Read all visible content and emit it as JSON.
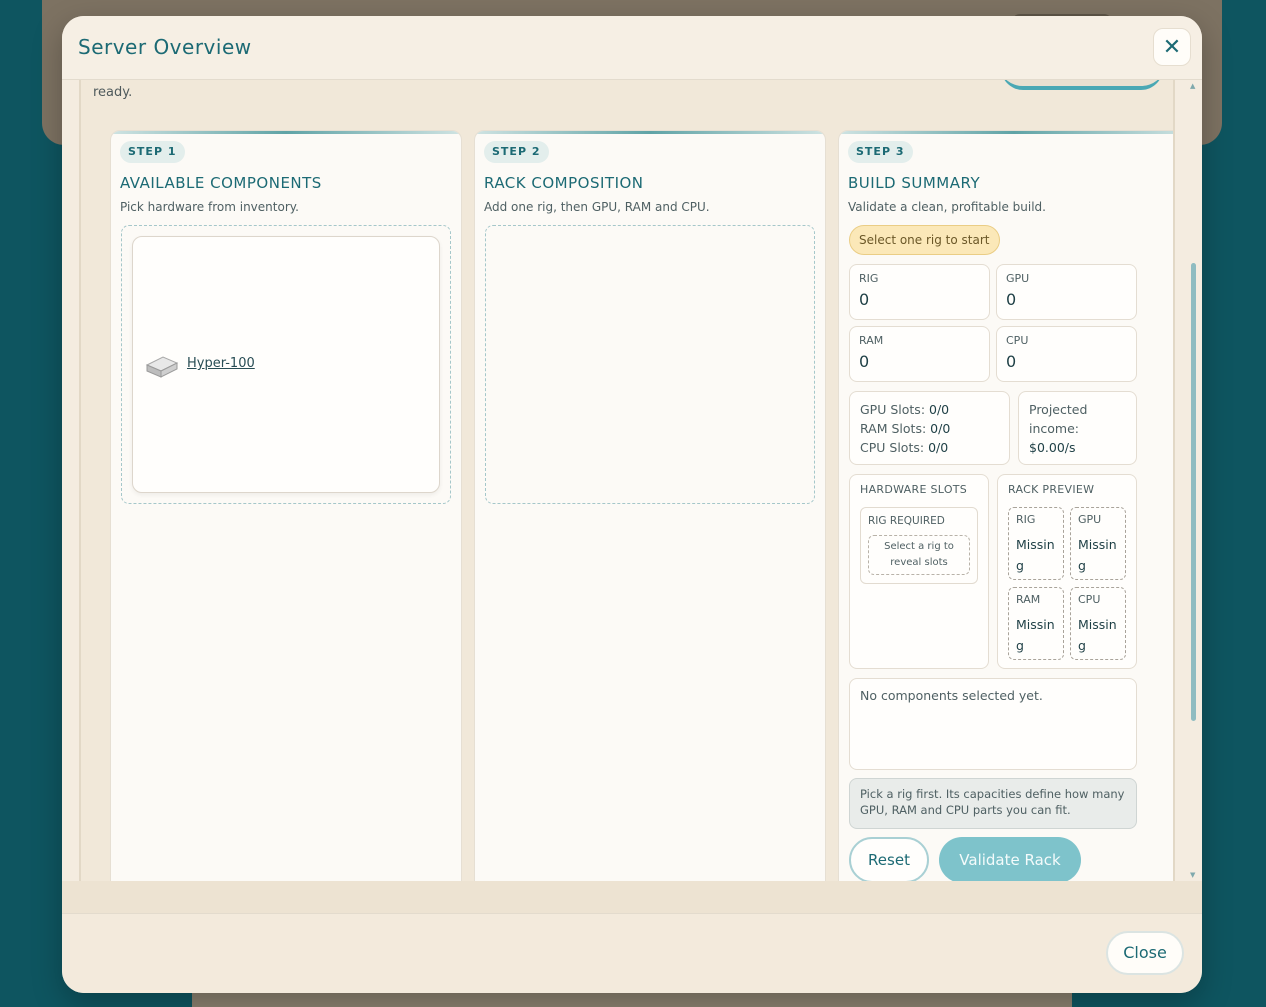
{
  "modal": {
    "title": "Server Overview",
    "close_icon": "close-icon",
    "ready_text": "ready.",
    "footer_close_label": "Close"
  },
  "steps": [
    {
      "step": "STEP 1",
      "title": "AVAILABLE COMPONENTS",
      "subtitle": "Pick hardware from inventory.",
      "components": [
        {
          "name": "Hyper-100",
          "icon": "server-rig-icon"
        }
      ]
    },
    {
      "step": "STEP 2",
      "title": "RACK COMPOSITION",
      "subtitle": "Add one rig, then GPU, RAM and CPU."
    },
    {
      "step": "STEP 3",
      "title": "BUILD SUMMARY",
      "subtitle": "Validate a clean, profitable build."
    }
  ],
  "summary": {
    "status_pill": "Select one rig to start",
    "counts": [
      {
        "label": "RIG",
        "value": "0"
      },
      {
        "label": "GPU",
        "value": "0"
      },
      {
        "label": "RAM",
        "value": "0"
      },
      {
        "label": "CPU",
        "value": "0"
      }
    ],
    "slots": {
      "gpu_label": "GPU Slots:",
      "gpu_value": "0/0",
      "ram_label": "RAM Slots:",
      "ram_value": "0/0",
      "cpu_label": "CPU Slots:",
      "cpu_value": "0/0"
    },
    "income": {
      "label_1": "Projected",
      "label_2": "income:",
      "value": "$0.00/s"
    },
    "hardware_slots": {
      "heading": "HARDWARE SLOTS",
      "rig_required": "RIG REQUIRED",
      "hint": "Select a rig to reveal slots"
    },
    "rack_preview": {
      "heading": "RACK PREVIEW",
      "slots": [
        {
          "label": "RIG",
          "value": "Missing"
        },
        {
          "label": "GPU",
          "value": "Missing"
        },
        {
          "label": "RAM",
          "value": "Missing"
        },
        {
          "label": "CPU",
          "value": "Missing"
        }
      ]
    },
    "selected_text": "No components selected yet.",
    "hint_text": "Pick a rig first. Its capacities define how many GPU, RAM and CPU parts you can fit.",
    "reset_label": "Reset",
    "validate_label": "Validate Rack"
  }
}
